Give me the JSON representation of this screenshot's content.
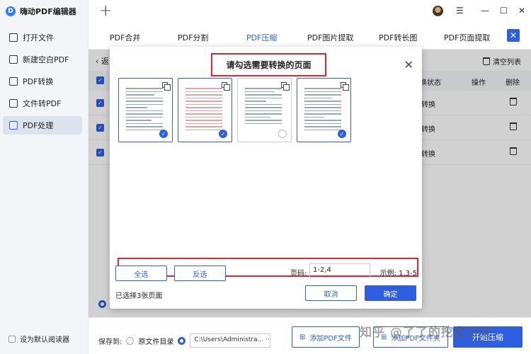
{
  "app": {
    "title": "嗨动PDF编辑器",
    "logo_char": "D"
  },
  "sidebar": {
    "items": [
      {
        "label": "打开文件",
        "icon": "open-file-icon"
      },
      {
        "label": "新建空白PDF",
        "icon": "new-pdf-icon"
      },
      {
        "label": "PDF转换",
        "icon": "convert-icon"
      },
      {
        "label": "文件转PDF",
        "icon": "file-to-pdf-icon"
      },
      {
        "label": "PDF处理",
        "icon": "pdf-process-icon",
        "active": true
      }
    ],
    "set_default": "设为默认阅读器"
  },
  "titlebar": {
    "plus": "+",
    "menu": "☰",
    "minimize": "—",
    "maximize": "☐",
    "close": "✕"
  },
  "tabs": [
    {
      "label": "PDF合并"
    },
    {
      "label": "PDF分割"
    },
    {
      "label": "PDF压缩",
      "active": true
    },
    {
      "label": "PDF图片提取"
    },
    {
      "label": "PDF转长图"
    },
    {
      "label": "PDF页面提取"
    }
  ],
  "tab_close": "✕",
  "list": {
    "back_label": "返",
    "clear_label": "清空列表",
    "headers": {
      "status": "换状态",
      "action": "操作",
      "delete": "删除"
    },
    "rows": [
      {
        "status": "转换"
      },
      {
        "status": "转换"
      },
      {
        "status": "转换"
      }
    ]
  },
  "dialog": {
    "title": "请勾选需要转换的页面",
    "close": "✕",
    "pages": [
      {
        "selected": true,
        "style": "text"
      },
      {
        "selected": true,
        "style": "table"
      },
      {
        "selected": false,
        "style": "text"
      },
      {
        "selected": true,
        "style": "text"
      }
    ],
    "select_all": "全选",
    "invert": "反选",
    "page_label": "页码:",
    "page_value": "1-2,4",
    "example": "示例: 1,3-5",
    "selected_count": "已选择3张页面",
    "cancel": "取消",
    "confirm": "确定"
  },
  "bottom": {
    "save_to": "保存到:",
    "original_dir": "原文件目录",
    "path": "C:\\Users\\Administra...",
    "path_more": "···",
    "add_pdf": "添加PDF文件",
    "add_folder": "添加PDF文件夹",
    "start": "开始压缩"
  },
  "watermark": "知乎 @了了的挖宝日记",
  "colors": {
    "accent": "#2e5fe0",
    "highlight": "#e0273a"
  }
}
